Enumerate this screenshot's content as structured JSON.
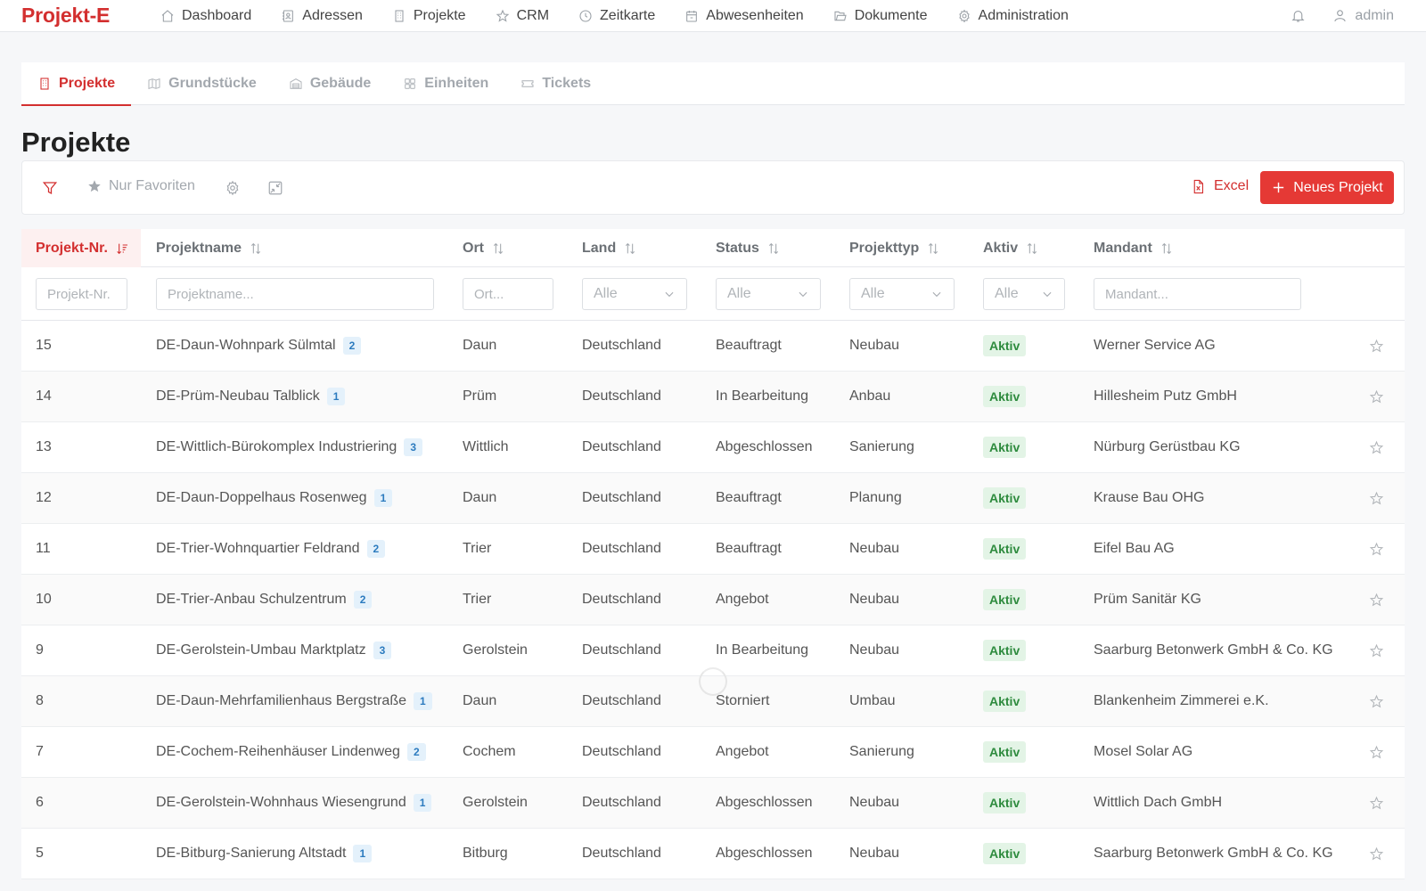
{
  "app": {
    "brand": "Projekt-E"
  },
  "nav": {
    "items": [
      {
        "label": "Dashboard",
        "icon": "home-icon"
      },
      {
        "label": "Adressen",
        "icon": "contact-book-icon"
      },
      {
        "label": "Projekte",
        "icon": "building-icon"
      },
      {
        "label": "CRM",
        "icon": "star-icon"
      },
      {
        "label": "Zeitkarte",
        "icon": "clock-icon"
      },
      {
        "label": "Abwesenheiten",
        "icon": "calendar-icon"
      },
      {
        "label": "Dokumente",
        "icon": "folder-icon"
      },
      {
        "label": "Administration",
        "icon": "gear-icon"
      }
    ],
    "user": "admin"
  },
  "tabs": [
    {
      "label": "Projekte",
      "icon": "building-icon",
      "active": true
    },
    {
      "label": "Grundstücke",
      "icon": "map-icon",
      "active": false
    },
    {
      "label": "Gebäude",
      "icon": "warehouse-icon",
      "active": false
    },
    {
      "label": "Einheiten",
      "icon": "grid-icon",
      "active": false
    },
    {
      "label": "Tickets",
      "icon": "ticket-icon",
      "active": false
    }
  ],
  "page": {
    "title": "Projekte"
  },
  "toolbar": {
    "favorites_label": "Nur Favoriten",
    "excel_label": "Excel",
    "new_label": "Neues Projekt"
  },
  "table": {
    "headers": [
      "Projekt-Nr.",
      "Projektname",
      "Ort",
      "Land",
      "Status",
      "Projekttyp",
      "Aktiv",
      "Mandant"
    ],
    "filters": {
      "nr_placeholder": "Projekt-Nr.",
      "name_placeholder": "Projektname...",
      "ort_placeholder": "Ort...",
      "land_value": "Alle",
      "status_value": "Alle",
      "typ_value": "Alle",
      "aktiv_value": "Alle",
      "mandant_placeholder": "Mandant..."
    },
    "rows": [
      {
        "nr": "15",
        "name": "DE-Daun-Wohnpark Sülmtal",
        "count": "2",
        "ort": "Daun",
        "land": "Deutschland",
        "status": "Beauftragt",
        "typ": "Neubau",
        "aktiv": "Aktiv",
        "mandant": "Werner Service AG"
      },
      {
        "nr": "14",
        "name": "DE-Prüm-Neubau Talblick",
        "count": "1",
        "ort": "Prüm",
        "land": "Deutschland",
        "status": "In Bearbeitung",
        "typ": "Anbau",
        "aktiv": "Aktiv",
        "mandant": "Hillesheim Putz GmbH"
      },
      {
        "nr": "13",
        "name": "DE-Wittlich-Bürokomplex Industriering",
        "count": "3",
        "ort": "Wittlich",
        "land": "Deutschland",
        "status": "Abgeschlossen",
        "typ": "Sanierung",
        "aktiv": "Aktiv",
        "mandant": "Nürburg Gerüstbau KG"
      },
      {
        "nr": "12",
        "name": "DE-Daun-Doppelhaus Rosenweg",
        "count": "1",
        "ort": "Daun",
        "land": "Deutschland",
        "status": "Beauftragt",
        "typ": "Planung",
        "aktiv": "Aktiv",
        "mandant": "Krause Bau OHG"
      },
      {
        "nr": "11",
        "name": "DE-Trier-Wohnquartier Feldrand",
        "count": "2",
        "ort": "Trier",
        "land": "Deutschland",
        "status": "Beauftragt",
        "typ": "Neubau",
        "aktiv": "Aktiv",
        "mandant": "Eifel Bau AG"
      },
      {
        "nr": "10",
        "name": "DE-Trier-Anbau Schulzentrum",
        "count": "2",
        "ort": "Trier",
        "land": "Deutschland",
        "status": "Angebot",
        "typ": "Neubau",
        "aktiv": "Aktiv",
        "mandant": "Prüm Sanitär KG"
      },
      {
        "nr": "9",
        "name": "DE-Gerolstein-Umbau Marktplatz",
        "count": "3",
        "ort": "Gerolstein",
        "land": "Deutschland",
        "status": "In Bearbeitung",
        "typ": "Neubau",
        "aktiv": "Aktiv",
        "mandant": "Saarburg Betonwerk GmbH & Co. KG"
      },
      {
        "nr": "8",
        "name": "DE-Daun-Mehrfamilienhaus Bergstraße",
        "count": "1",
        "ort": "Daun",
        "land": "Deutschland",
        "status": "Storniert",
        "typ": "Umbau",
        "aktiv": "Aktiv",
        "mandant": "Blankenheim Zimmerei e.K."
      },
      {
        "nr": "7",
        "name": "DE-Cochem-Reihenhäuser Lindenweg",
        "count": "2",
        "ort": "Cochem",
        "land": "Deutschland",
        "status": "Angebot",
        "typ": "Sanierung",
        "aktiv": "Aktiv",
        "mandant": "Mosel Solar AG"
      },
      {
        "nr": "6",
        "name": "DE-Gerolstein-Wohnhaus Wiesengrund",
        "count": "1",
        "ort": "Gerolstein",
        "land": "Deutschland",
        "status": "Abgeschlossen",
        "typ": "Neubau",
        "aktiv": "Aktiv",
        "mandant": "Wittlich Dach GmbH"
      },
      {
        "nr": "5",
        "name": "DE-Bitburg-Sanierung Altstadt",
        "count": "1",
        "ort": "Bitburg",
        "land": "Deutschland",
        "status": "Abgeschlossen",
        "typ": "Neubau",
        "aktiv": "Aktiv",
        "mandant": "Saarburg Betonwerk GmbH & Co. KG"
      }
    ]
  },
  "colors": {
    "accent": "#d32f2f",
    "primary_button": "#e53935",
    "aktiv_badge": "#2e8b3e",
    "count_badge": "#2c7bbf"
  }
}
